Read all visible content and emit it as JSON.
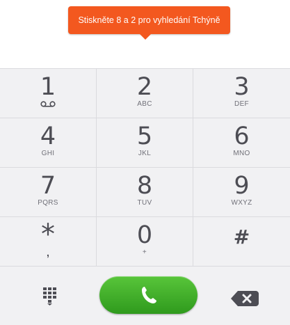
{
  "tooltip": {
    "text": "Stiskněte 8 a 2 pro vyhledání Tchýně"
  },
  "keypad": {
    "keys": [
      {
        "digit": "1",
        "letters": ""
      },
      {
        "digit": "2",
        "letters": "ABC"
      },
      {
        "digit": "3",
        "letters": "DEF"
      },
      {
        "digit": "4",
        "letters": "GHI"
      },
      {
        "digit": "5",
        "letters": "JKL"
      },
      {
        "digit": "6",
        "letters": "MNO"
      },
      {
        "digit": "7",
        "letters": "PQRS"
      },
      {
        "digit": "8",
        "letters": "TUV"
      },
      {
        "digit": "9",
        "letters": "WXYZ"
      },
      {
        "digit": "*",
        "letters": ","
      },
      {
        "digit": "0",
        "letters": "+"
      },
      {
        "digit": "#",
        "letters": ""
      }
    ]
  },
  "icons": {
    "voicemail": "voicemail-icon",
    "dialpad": "dialpad-icon",
    "call": "phone-icon",
    "backspace": "backspace-icon"
  },
  "colors": {
    "tooltip": "#f3581f",
    "call_button": "#3aa82a",
    "keypad_bg": "#f1f1f3",
    "digit_text": "#4d4d54"
  }
}
